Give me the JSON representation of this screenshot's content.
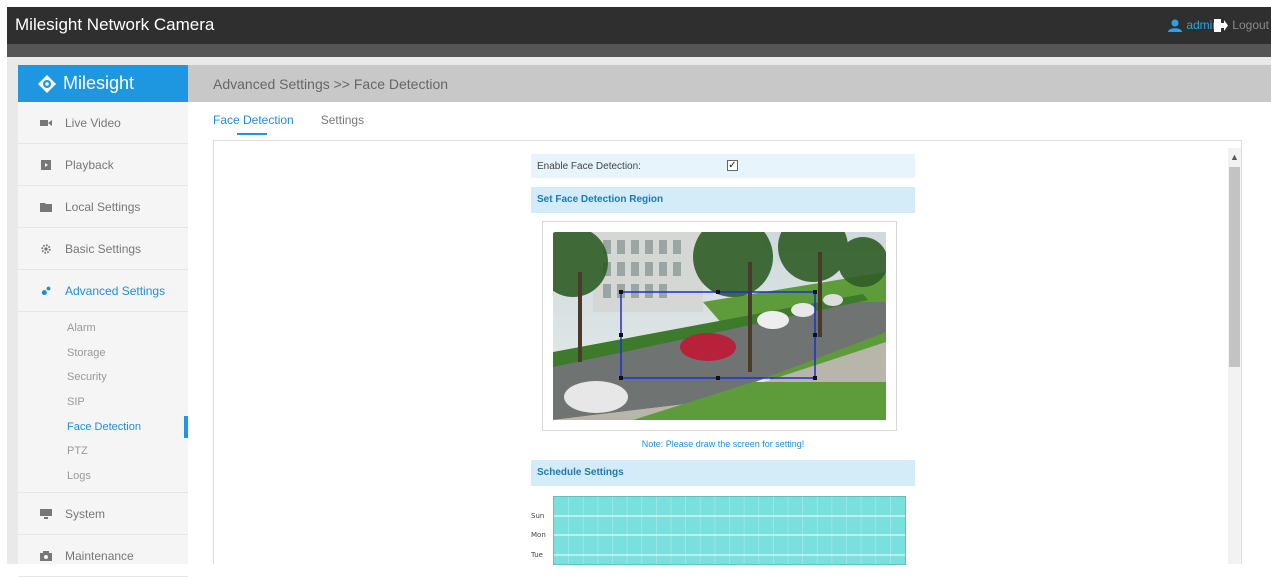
{
  "app": {
    "title": "Milesight Network Camera",
    "user": "admin",
    "logout": "Logout",
    "accent": "#1e97e0"
  },
  "sidebar": {
    "logo": "Milesight",
    "items": [
      {
        "label": "Live Video",
        "icon": "video-camera-icon"
      },
      {
        "label": "Playback",
        "icon": "playback-icon"
      },
      {
        "label": "Local Settings",
        "icon": "folder-icon"
      },
      {
        "label": "Basic Settings",
        "icon": "gear-icon"
      },
      {
        "label": "Advanced Settings",
        "icon": "advanced-settings-icon",
        "active": true
      }
    ],
    "sub_items": [
      "Alarm",
      "Storage",
      "Security",
      "SIP",
      "Face Detection",
      "PTZ",
      "Logs"
    ],
    "active_sub": "Face Detection",
    "bottom_items": [
      {
        "label": "System",
        "icon": "monitor-icon"
      },
      {
        "label": "Maintenance",
        "icon": "maintenance-icon"
      }
    ]
  },
  "header": {
    "breadcrumb": "Advanced Settings >> Face Detection"
  },
  "tabs": [
    {
      "label": "Face Detection",
      "active": true
    },
    {
      "label": "Settings",
      "active": false
    }
  ],
  "form": {
    "enable_label": "Enable Face Detection:",
    "enable_checked": true,
    "region_title": "Set Face Detection Region",
    "note": "Note: Please draw the screen for setting!",
    "schedule_title": "Schedule Settings",
    "schedule_days": [
      "Sun",
      "Mon",
      "Tue"
    ]
  }
}
